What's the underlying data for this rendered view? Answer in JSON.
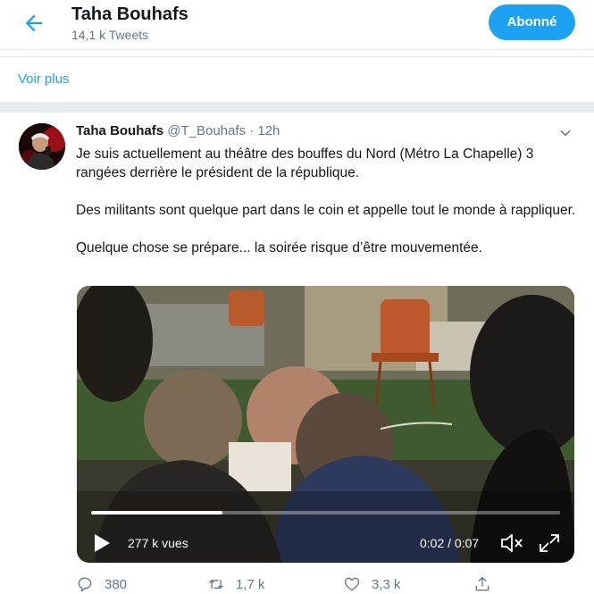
{
  "header": {
    "title": "Taha Bouhafs",
    "subtitle": "14,1 k Tweets",
    "follow_label": "Abonné"
  },
  "see_more": {
    "label": "Voir plus"
  },
  "tweet": {
    "name": "Taha Bouhafs",
    "handle": "@T_Bouhafs",
    "dot": "·",
    "time": "12h",
    "paragraphs": [
      "Je suis actuellement au théâtre des bouffes du Nord (Métro La Chapelle) 3 rangées derrière le président de la république.",
      "Des militants sont quelque part dans le coin et appelle tout le monde à rappliquer.",
      "Quelque chose se prépare... la soirée risque d’être mouvementée."
    ],
    "video": {
      "views": "277 k vues",
      "time": "0:02 / 0:07",
      "progress": 0.28
    },
    "actions": {
      "replies": "380",
      "retweets": "1,7 k",
      "likes": "3,3 k"
    }
  },
  "colors": {
    "accent": "#1da1f2",
    "muted": "#657786",
    "text": "#14171a",
    "border": "#e6ecf0"
  },
  "icons": [
    "back-arrow-icon",
    "chevron-down-icon",
    "play-icon",
    "mute-icon",
    "fullscreen-icon",
    "reply-icon",
    "retweet-icon",
    "like-icon",
    "share-icon"
  ]
}
